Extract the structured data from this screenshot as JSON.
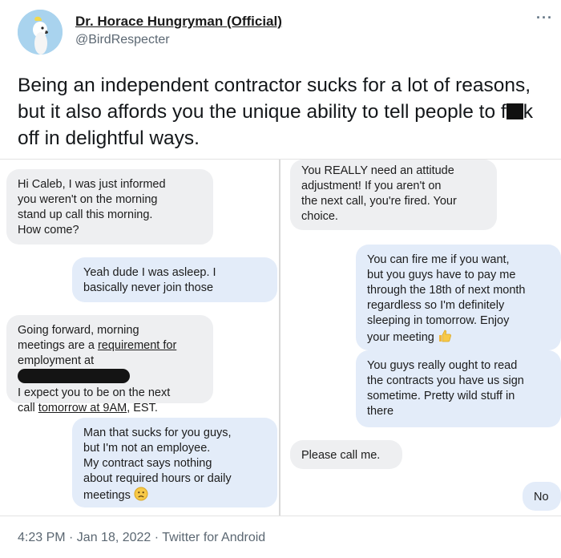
{
  "tweet": {
    "display_name": "Dr. Horace Hungryman (Official)",
    "handle": "@BirdRespecter",
    "more_label": "···",
    "text_part1": "Being an independent contractor sucks for a lot of reasons, but it also affords you the unique ability to tell people to f",
    "text_part2": "k off in delightful ways.",
    "timestamp": "4:23 PM · Jan 18, 2022 · Twitter for Android"
  },
  "left_thread": [
    {
      "type": "received",
      "text": "Hi Caleb, I was just informed\nyou weren't on the morning\nstand up call this morning.\nHow come?"
    },
    {
      "type": "sent",
      "text": "Yeah dude I was asleep. I\nbasically never join those"
    },
    {
      "type": "received",
      "text_part1": "Going forward, morning\nmeetings are a ",
      "link1": "requirement for",
      "text_part2": "\nemployment at ",
      "text_part3": "\nI expect you to be on the next\ncall ",
      "link2": "tomorrow at 9AM",
      "text_part4": ", EST."
    },
    {
      "type": "sent",
      "text": "Man that sucks for you guys,\nbut I'm not an employee.\nMy contract says nothing\nabout required hours or daily\nmeetings"
    }
  ],
  "right_thread": [
    {
      "type": "received",
      "text": "You REALLY need an attitude\nadjustment! If you aren't on\nthe next call, you're fired. Your\nchoice."
    },
    {
      "type": "sent",
      "text": "You can fire me if you want,\nbut you guys have to pay me\nthrough the 18th of next month\nregardless so I'm definitely\nsleeping in tomorrow. Enjoy\nyour meeting"
    },
    {
      "type": "sent",
      "text": "You guys really ought to read\nthe contracts you have us sign\nsometime. Pretty wild stuff in\nthere"
    },
    {
      "type": "received",
      "text": "Please call me."
    },
    {
      "type": "sent",
      "text": "No"
    }
  ],
  "icons": {
    "frown": "slightly-frowning-face-emoji",
    "thumbs": "thumbs-up-emoji"
  }
}
